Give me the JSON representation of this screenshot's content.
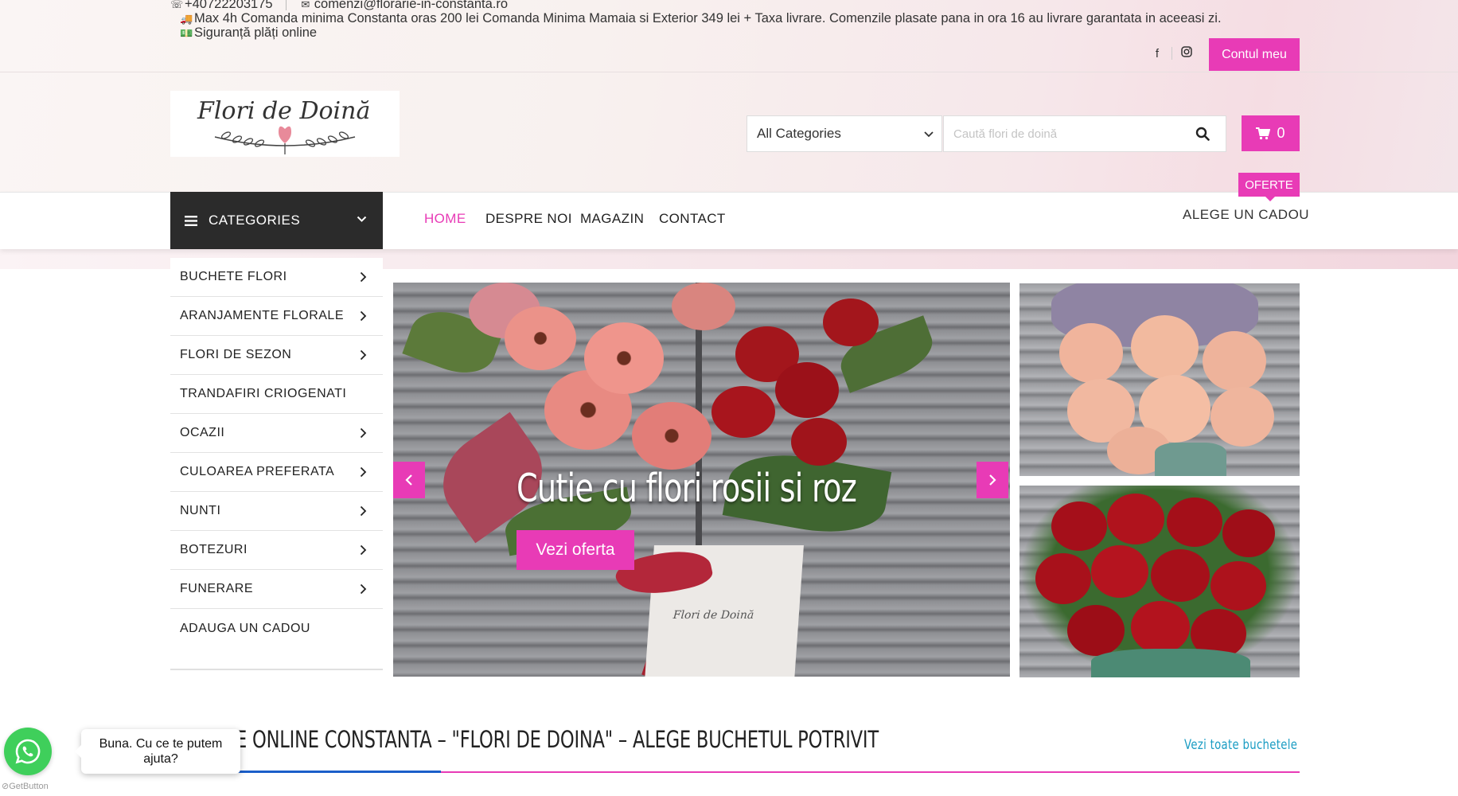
{
  "topbar": {
    "phone": "+40722203175",
    "email": "comenzi@florarie-in-constanta.ro",
    "delivery_note": "Max 4h Comanda minima Constanta oras 200 lei Comanda Minima Mamaia si Exterior 349 lei + Taxa livrare. Comenzile plasate pana in ora 16 au livrare garantata in aceeasi zi.",
    "secure_payments": "Siguranță plăți online",
    "account_button": "Contul meu"
  },
  "logo": {
    "text": "Flori de Doină"
  },
  "search": {
    "category_selected": "All Categories",
    "placeholder": "Caută flori de doină"
  },
  "cart": {
    "count": "0"
  },
  "nav": {
    "categories_label": "CATEGORIES",
    "items": [
      "HOME",
      "DESPRE NOI",
      "MAGAZIN",
      "CONTACT"
    ],
    "offers_badge": "OFERTE",
    "gift_link": "ALEGE UN CADOU"
  },
  "categories": [
    {
      "label": "BUCHETE FLORI",
      "has_sub": true
    },
    {
      "label": "ARANJAMENTE FLORALE",
      "has_sub": true
    },
    {
      "label": "FLORI DE SEZON",
      "has_sub": true
    },
    {
      "label": "TRANDAFIRI CRIOGENATI",
      "has_sub": false
    },
    {
      "label": "OCAZII",
      "has_sub": true
    },
    {
      "label": "CULOAREA PREFERATA",
      "has_sub": true
    },
    {
      "label": "NUNTI",
      "has_sub": true
    },
    {
      "label": "BOTEZURI",
      "has_sub": true
    },
    {
      "label": "FUNERARE",
      "has_sub": true
    },
    {
      "label": "ADAUGA UN CADOU",
      "has_sub": false
    }
  ],
  "slider": {
    "title": "Cutie cu flori rosii si roz",
    "button": "Vezi oferta",
    "box_logo": "Flori de Doină"
  },
  "section": {
    "title": "E ONLINE CONSTANTA – \"FLORI DE DOINA\" – ALEGE BUCHETUL POTRIVIT",
    "see_all": "Vezi toate buchetele"
  },
  "whatsapp": {
    "message": "Buna. Cu ce te putem ajuta?",
    "brand": "GetButton"
  },
  "colors": {
    "accent": "#e83bb6",
    "dark": "#2b2b2b",
    "link": "#1a9cc3",
    "whatsapp": "#3fcf5b"
  }
}
